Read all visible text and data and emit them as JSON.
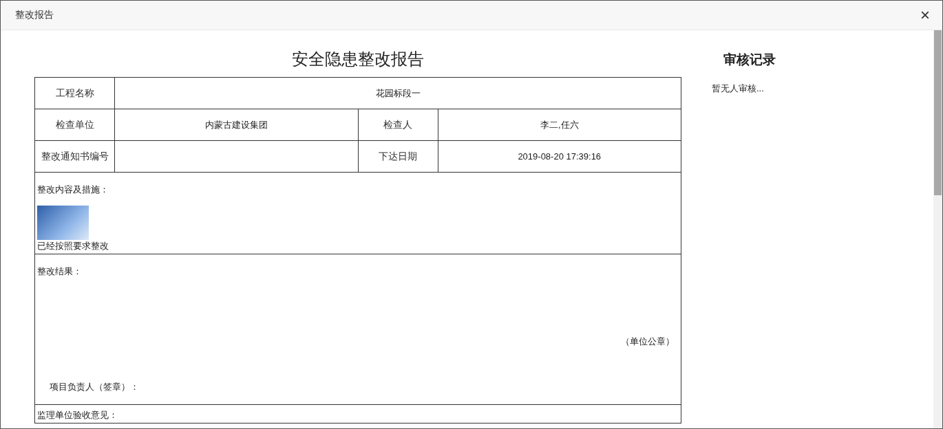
{
  "dialog": {
    "title": "整改报告",
    "close": "×"
  },
  "report": {
    "title": "安全隐患整改报告",
    "rows": [
      {
        "cells": [
          {
            "text": "工程名称",
            "kind": "label"
          },
          {
            "text": "花园标段一",
            "kind": "value",
            "colspan": 3
          }
        ]
      },
      {
        "cells": [
          {
            "text": "检查单位",
            "kind": "label"
          },
          {
            "text": "内蒙古建设集团",
            "kind": "value"
          },
          {
            "text": "检查人",
            "kind": "label"
          },
          {
            "text": "李二,任六",
            "kind": "value"
          }
        ]
      },
      {
        "cells": [
          {
            "text": "整改通知书编号",
            "kind": "label"
          },
          {
            "kind": "value"
          },
          {
            "text": "下达日期",
            "kind": "label"
          },
          {
            "text": "2019-08-20 17:39:16",
            "kind": "value"
          }
        ]
      }
    ],
    "measures": {
      "label": "整改内容及措施：",
      "description": "已经按照要求整改"
    },
    "result": {
      "label": "整改结果：",
      "seal": "（单位公章）",
      "signer": "项目负责人（签章）："
    },
    "acceptance": {
      "label": "监理单位验收意见："
    }
  },
  "review": {
    "title": "审核记录",
    "empty": "暂无人审核..."
  }
}
